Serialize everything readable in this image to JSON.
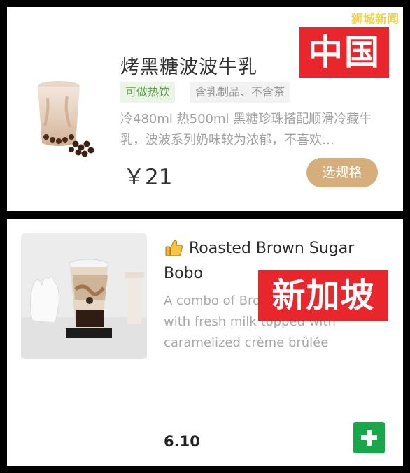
{
  "watermark": "狮城新闻",
  "china_card": {
    "region_label": "中国",
    "product_name": "烤黑糖波波牛乳",
    "tags": [
      "可做热饮",
      "含乳制品、不含茶"
    ],
    "description": "冷480ml 热500ml 黑糖珍珠搭配顺滑冷藏牛乳，波波系列奶味较为浓郁，不喜欢…",
    "price": "￥21",
    "select_button": "选规格",
    "image_icon": "bubble-tea-cup-icon"
  },
  "singapore_card": {
    "region_label": "新加坡",
    "recommend_icon": "thumbs-up-icon",
    "product_name": "Roasted Brown Sugar Bobo",
    "description": "A combo of Brown sugar bobo with fresh milk topped with caramelized crème brûlée",
    "price": "6.10",
    "add_icon": "plus-icon"
  },
  "colors": {
    "region_label_bg": "#e8262c",
    "select_button_bg": "#d5ae7b",
    "add_button_bg": "#18a84b",
    "hot_tag_text": "#5e9f4c",
    "watermark": "#f1d34a"
  }
}
